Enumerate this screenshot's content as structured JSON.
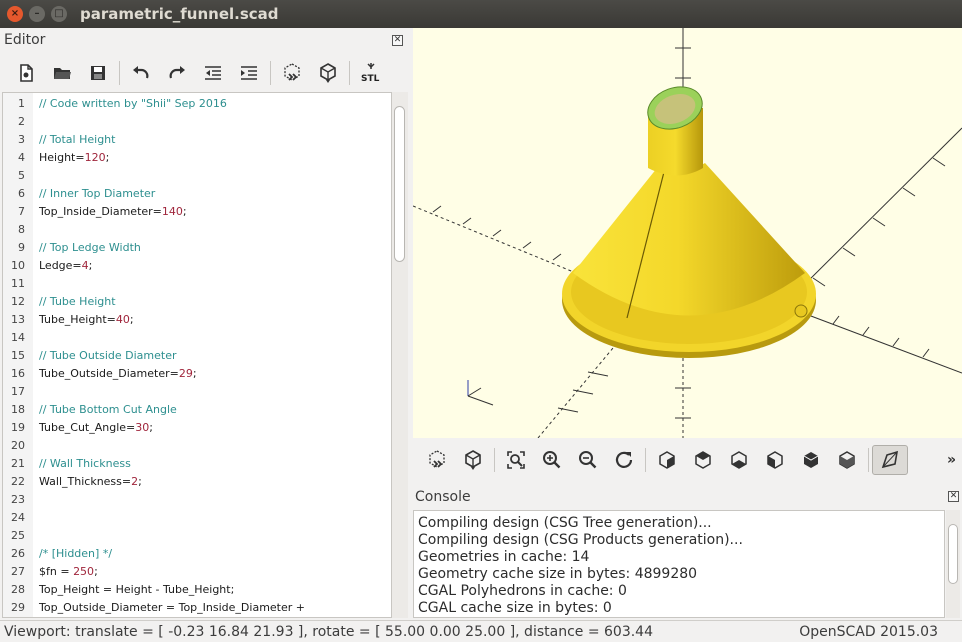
{
  "window": {
    "title": "parametric_funnel.scad"
  },
  "editor": {
    "title": "Editor",
    "toolbar": [
      "new-file-icon",
      "open-file-icon",
      "save-icon",
      "undo-icon",
      "redo-icon",
      "unindent-icon",
      "indent-icon",
      "preview-icon",
      "render-icon",
      "export-stl-icon"
    ],
    "stl_label": "STL",
    "lines": [
      {
        "n": "1",
        "parts": [
          {
            "t": "// Code written by \"Shii\" Sep 2016",
            "c": "cm"
          }
        ]
      },
      {
        "n": "2",
        "parts": []
      },
      {
        "n": "3",
        "parts": [
          {
            "t": "// Total Height",
            "c": "cm"
          }
        ]
      },
      {
        "n": "4",
        "parts": [
          {
            "t": "Height=",
            "c": ""
          },
          {
            "t": "120",
            "c": "num"
          },
          {
            "t": ";",
            "c": ""
          }
        ]
      },
      {
        "n": "5",
        "parts": []
      },
      {
        "n": "6",
        "parts": [
          {
            "t": "// Inner Top Diameter",
            "c": "cm"
          }
        ]
      },
      {
        "n": "7",
        "parts": [
          {
            "t": "Top_Inside_Diameter=",
            "c": ""
          },
          {
            "t": "140",
            "c": "num"
          },
          {
            "t": ";",
            "c": ""
          }
        ]
      },
      {
        "n": "8",
        "parts": []
      },
      {
        "n": "9",
        "parts": [
          {
            "t": "// Top Ledge Width",
            "c": "cm"
          }
        ]
      },
      {
        "n": "10",
        "parts": [
          {
            "t": "Ledge=",
            "c": ""
          },
          {
            "t": "4",
            "c": "num"
          },
          {
            "t": ";",
            "c": ""
          }
        ]
      },
      {
        "n": "11",
        "parts": []
      },
      {
        "n": "12",
        "parts": [
          {
            "t": "// Tube Height",
            "c": "cm"
          }
        ]
      },
      {
        "n": "13",
        "parts": [
          {
            "t": "Tube_Height=",
            "c": ""
          },
          {
            "t": "40",
            "c": "num"
          },
          {
            "t": ";",
            "c": ""
          }
        ]
      },
      {
        "n": "14",
        "parts": []
      },
      {
        "n": "15",
        "parts": [
          {
            "t": "// Tube Outside Diameter",
            "c": "cm"
          }
        ]
      },
      {
        "n": "16",
        "parts": [
          {
            "t": "Tube_Outside_Diameter=",
            "c": ""
          },
          {
            "t": "29",
            "c": "num"
          },
          {
            "t": ";",
            "c": ""
          }
        ]
      },
      {
        "n": "17",
        "parts": []
      },
      {
        "n": "18",
        "parts": [
          {
            "t": "// Tube Bottom Cut Angle",
            "c": "cm"
          }
        ]
      },
      {
        "n": "19",
        "parts": [
          {
            "t": "Tube_Cut_Angle=",
            "c": ""
          },
          {
            "t": "30",
            "c": "num"
          },
          {
            "t": ";",
            "c": ""
          }
        ]
      },
      {
        "n": "20",
        "parts": []
      },
      {
        "n": "21",
        "parts": [
          {
            "t": "// Wall Thickness",
            "c": "cm"
          }
        ]
      },
      {
        "n": "22",
        "parts": [
          {
            "t": "Wall_Thickness=",
            "c": ""
          },
          {
            "t": "2",
            "c": "num"
          },
          {
            "t": ";",
            "c": ""
          }
        ]
      },
      {
        "n": "23",
        "parts": []
      },
      {
        "n": "24",
        "parts": []
      },
      {
        "n": "25",
        "parts": []
      },
      {
        "n": "26",
        "parts": [
          {
            "t": "/* [Hidden] */",
            "c": "cm"
          }
        ]
      },
      {
        "n": "27",
        "parts": [
          {
            "t": "$fn = ",
            "c": ""
          },
          {
            "t": "250",
            "c": "num"
          },
          {
            "t": ";",
            "c": ""
          }
        ]
      },
      {
        "n": "28",
        "parts": [
          {
            "t": "Top_Height = Height - Tube_Height;",
            "c": ""
          }
        ]
      },
      {
        "n": "29",
        "parts": [
          {
            "t": "Top_Outside_Diameter = Top_Inside_Diameter +",
            "c": ""
          }
        ]
      }
    ]
  },
  "viewport": {
    "colors": {
      "background": "#fffee6",
      "model": "#f5d829",
      "model_shade": "#c9a80f",
      "tube_rim": "#9bd15a"
    }
  },
  "view_toolbar": [
    "preview-icon",
    "render-icon",
    "view-all-icon",
    "zoom-in-icon",
    "zoom-out-icon",
    "reset-view-icon",
    "view-right-icon",
    "view-top-icon",
    "view-bottom-icon",
    "view-left-icon",
    "view-front-icon",
    "view-back-icon",
    "perspective-icon",
    "more-icon"
  ],
  "console": {
    "title": "Console",
    "lines": [
      "Compiling design (CSG Tree generation)...",
      "Compiling design (CSG Products generation)...",
      "Geometries in cache: 14",
      "Geometry cache size in bytes: 4899280",
      "CGAL Polyhedrons in cache: 0",
      "CGAL cache size in bytes: 0"
    ]
  },
  "status": {
    "viewport": "Viewport: translate = [ -0.23 16.84 21.93 ], rotate = [ 55.00 0.00 25.00 ], distance = 603.44",
    "version": "OpenSCAD 2015.03"
  }
}
